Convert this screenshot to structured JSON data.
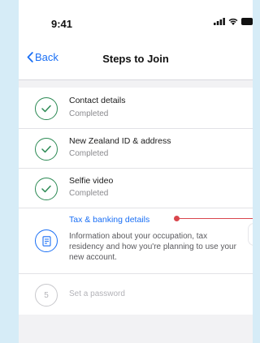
{
  "status_bar": {
    "time": "9:41",
    "icons": [
      "signal-icon",
      "wifi-icon",
      "battery-icon"
    ]
  },
  "nav": {
    "back_label": "Back",
    "title": "Steps to Join"
  },
  "steps": [
    {
      "title": "Contact details",
      "status": "Completed",
      "state": "done"
    },
    {
      "title": "New Zealand ID & address",
      "status": "Completed",
      "state": "done"
    },
    {
      "title": "Selfie video",
      "status": "Completed",
      "state": "done"
    },
    {
      "title": "Tax & banking details",
      "description": "Information about your occupation, tax residency and how you're planning to use your new account.",
      "state": "active"
    },
    {
      "number": "5",
      "title": "Set a password",
      "state": "pending"
    }
  ],
  "colors": {
    "accent": "#1a6ff5",
    "done": "#2c8a54",
    "annotation": "#d9464d",
    "background": "#d6ecf7"
  }
}
